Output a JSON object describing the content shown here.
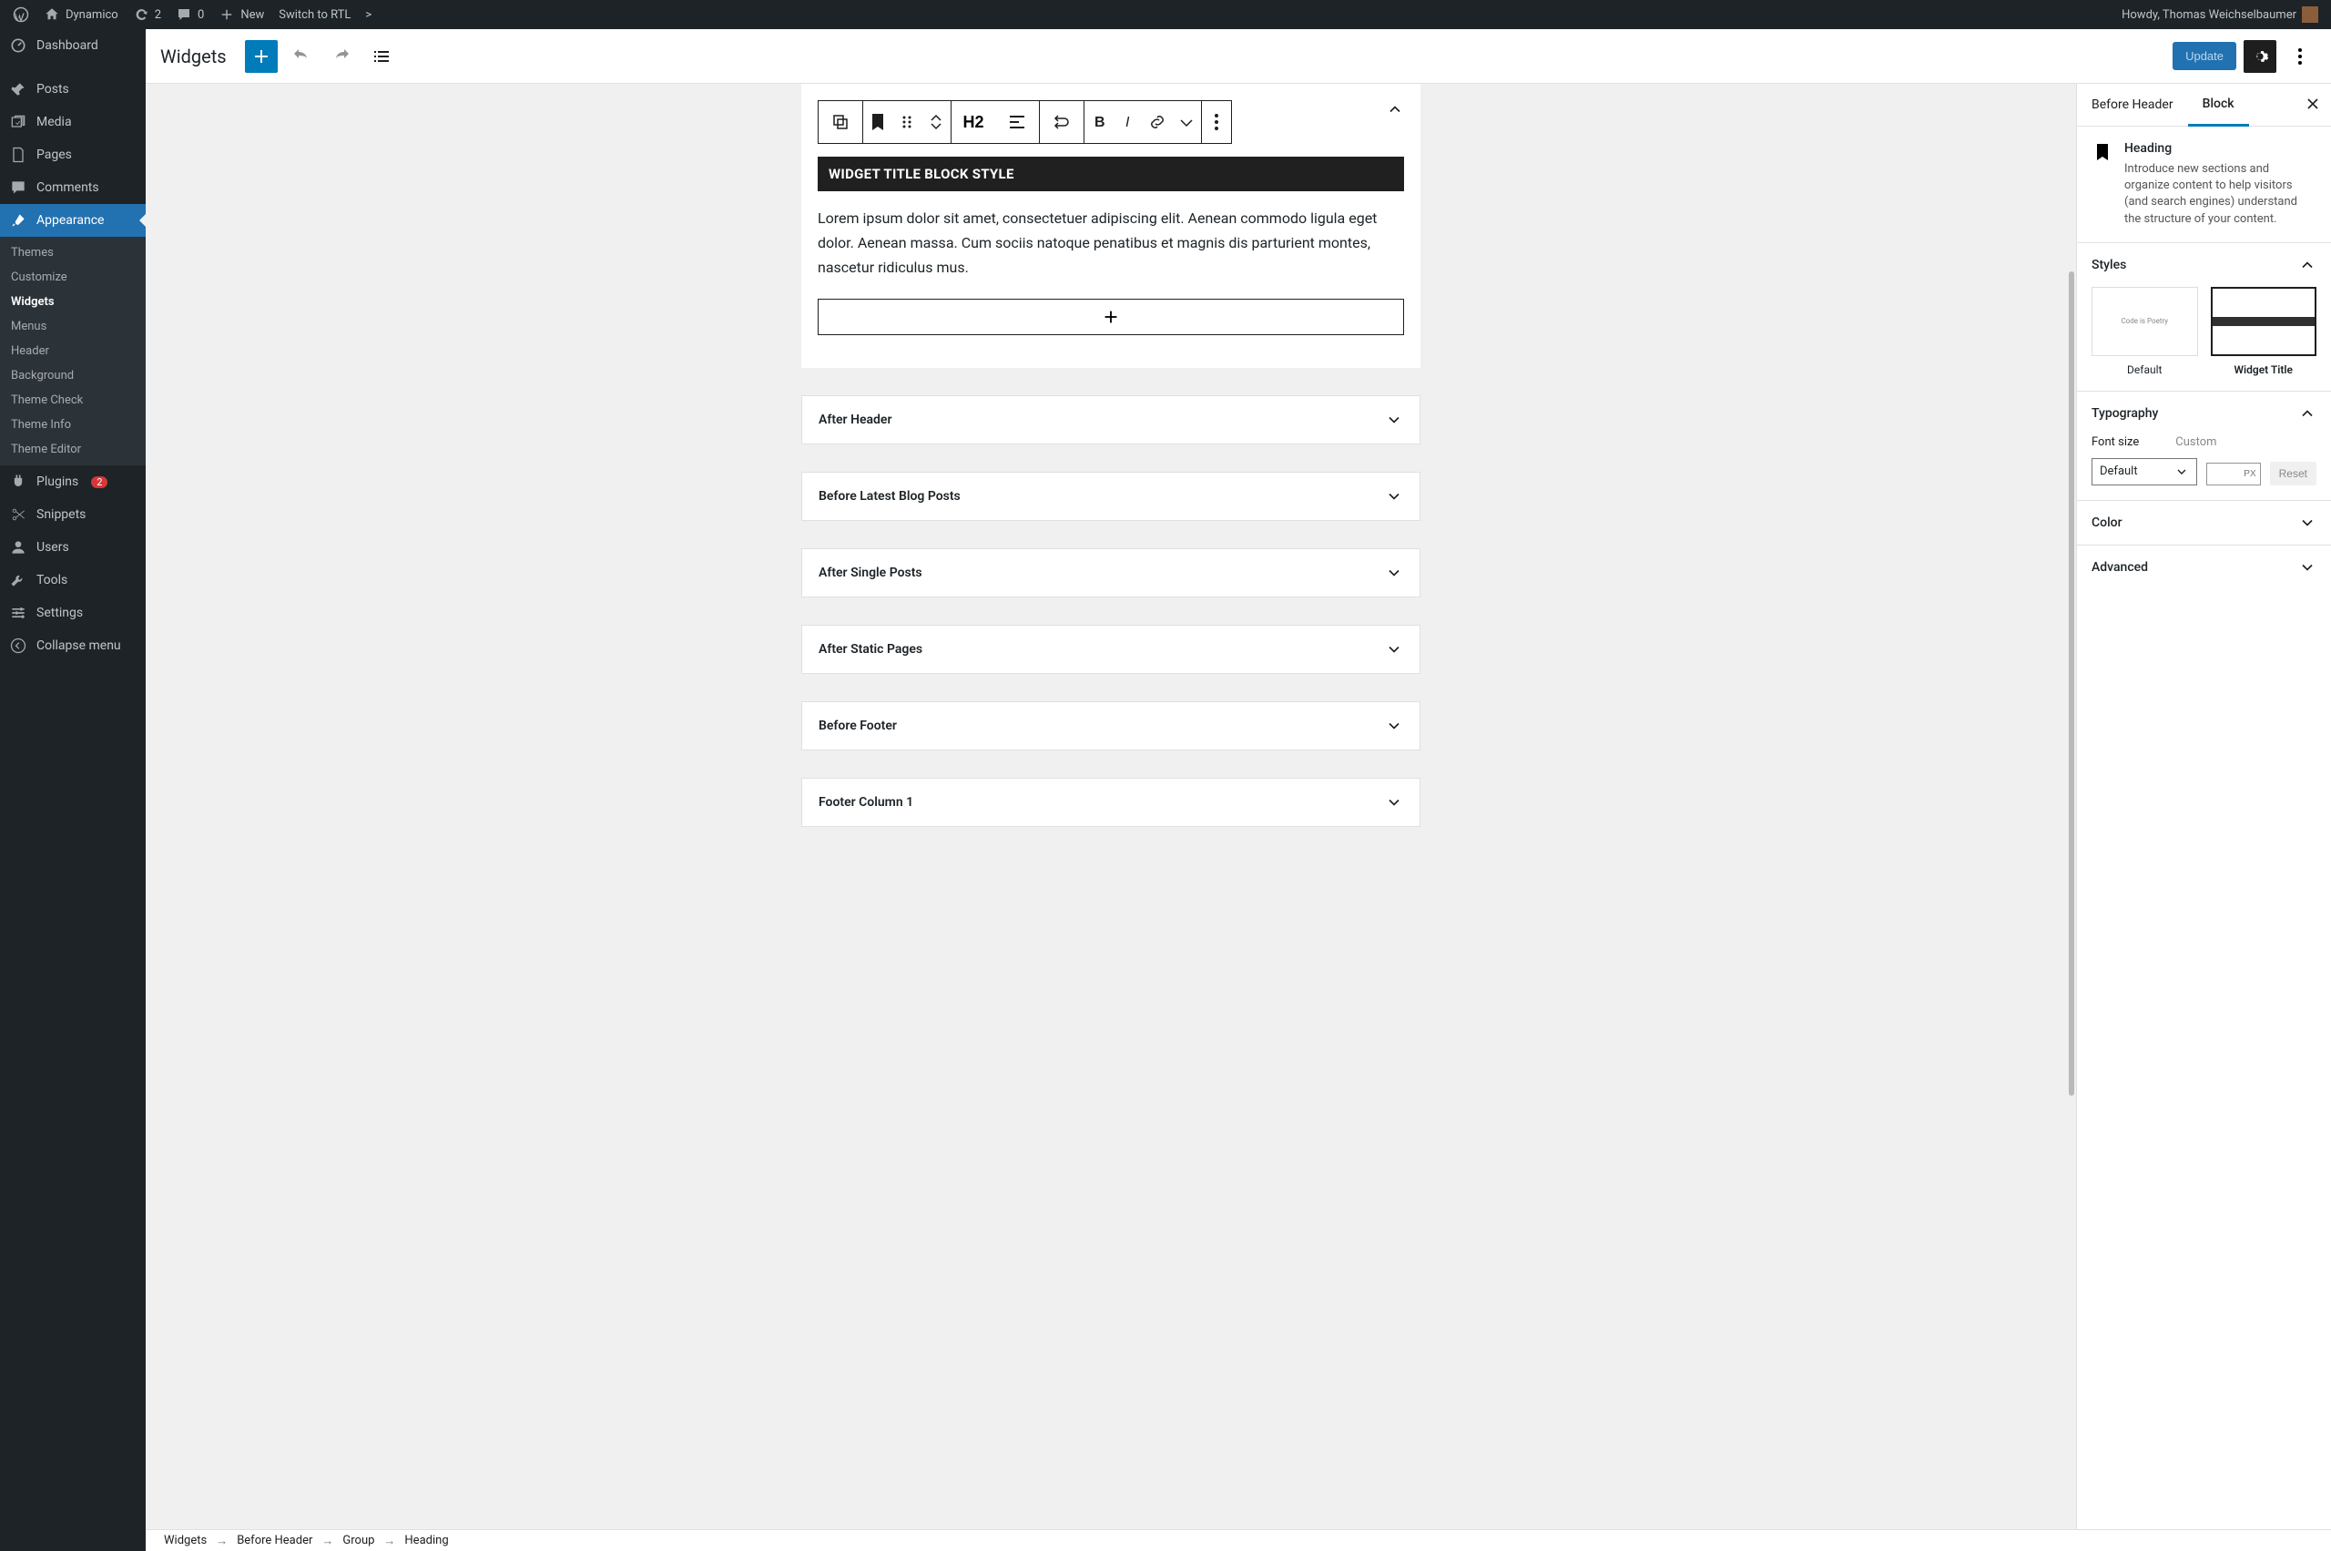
{
  "adminbar": {
    "site": "Dynamico",
    "updates": "2",
    "comments": "0",
    "new": "New",
    "switch_rtl": "Switch to RTL",
    "arrow": ">",
    "greeting": "Howdy, Thomas Weichselbaumer"
  },
  "sidebar": {
    "dashboard": "Dashboard",
    "posts": "Posts",
    "media": "Media",
    "pages": "Pages",
    "comments": "Comments",
    "appearance": "Appearance",
    "appearance_sub": {
      "themes": "Themes",
      "customize": "Customize",
      "widgets": "Widgets",
      "menus": "Menus",
      "header": "Header",
      "background": "Background",
      "theme_check": "Theme Check",
      "theme_info": "Theme Info",
      "theme_editor": "Theme Editor"
    },
    "plugins": "Plugins",
    "plugins_badge": "2",
    "snippets": "Snippets",
    "users": "Users",
    "tools": "Tools",
    "settings": "Settings",
    "collapse": "Collapse menu"
  },
  "editor_header": {
    "title": "Widgets",
    "update": "Update"
  },
  "canvas": {
    "area_open_title": "Before Header",
    "heading_text": "WIDGET TITLE BLOCK STYLE",
    "paragraph": "Lorem ipsum dolor sit amet, consectetuer adipiscing elit. Aenean commodo ligula eget dolor. Aenean massa. Cum sociis natoque penatibus et magnis dis parturient montes, nascetur ridiculus mus.",
    "h2_label": "H2",
    "areas": [
      "After Header",
      "Before Latest Blog Posts",
      "After Single Posts",
      "After Static Pages",
      "Before Footer",
      "Footer Column 1"
    ]
  },
  "inspector": {
    "tab_area": "Before Header",
    "tab_block": "Block",
    "block_title": "Heading",
    "block_desc": "Introduce new sections and organize content to help visitors (and search engines) understand the structure of your content.",
    "styles_label": "Styles",
    "style_default": "Default",
    "style_default_preview": "Code is Poetry",
    "style_widget_title": "Widget Title",
    "typography_label": "Typography",
    "font_size_label": "Font size",
    "font_size_value": "Default",
    "custom_label": "Custom",
    "custom_unit": "PX",
    "reset": "Reset",
    "color_label": "Color",
    "advanced_label": "Advanced"
  },
  "breadcrumb": {
    "items": [
      "Widgets",
      "Before Header",
      "Group",
      "Heading"
    ]
  }
}
